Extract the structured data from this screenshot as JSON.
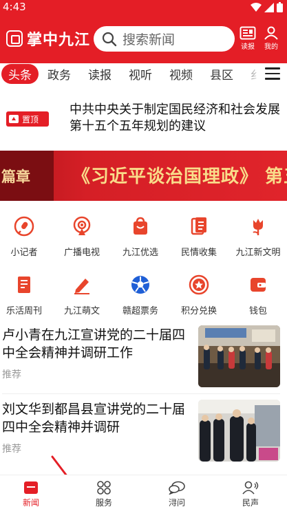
{
  "status": {
    "time": "4:43"
  },
  "app": {
    "title": "掌中九江"
  },
  "search": {
    "placeholder": "搜索新闻"
  },
  "header_buttons": {
    "read_paper": "读报",
    "mine": "我的"
  },
  "tabs": [
    {
      "label": "头条",
      "active": true
    },
    {
      "label": "政务",
      "active": false
    },
    {
      "label": "读报",
      "active": false
    },
    {
      "label": "视听",
      "active": false
    },
    {
      "label": "视频",
      "active": false
    },
    {
      "label": "县区",
      "active": false
    },
    {
      "label": "纟",
      "active": false
    }
  ],
  "pinned": {
    "badge": "置顶",
    "title": "中共中央关于制定国民经济和社会发展第十五个五年规划的建议"
  },
  "banner": {
    "left_text": "篇章",
    "text": "《习近平谈治国理政》 第五"
  },
  "services_row1": [
    {
      "label": "小记者",
      "icon": "microphone-icon"
    },
    {
      "label": "广播电视",
      "icon": "broadcast-icon"
    },
    {
      "label": "九江优选",
      "icon": "shopping-bag-icon"
    },
    {
      "label": "民情收集",
      "icon": "document-icon"
    },
    {
      "label": "九江新文明",
      "icon": "flower-icon"
    }
  ],
  "services_row2": [
    {
      "label": "乐活周刊",
      "icon": "journal-icon"
    },
    {
      "label": "九江萌文",
      "icon": "pen-icon"
    },
    {
      "label": "赣超票务",
      "icon": "soccer-ball-icon"
    },
    {
      "label": "积分兑换",
      "icon": "star-badge-icon"
    },
    {
      "label": "钱包",
      "icon": "wallet-icon"
    }
  ],
  "news": [
    {
      "title": "卢小青在九江宣讲党的二十届四中全会精神并调研工作",
      "tag": "推荐"
    },
    {
      "title": "刘文华到都昌县宣讲党的二十届四中全会精神并调研",
      "tag": "推荐"
    }
  ],
  "bottom_nav": [
    {
      "label": "新闻",
      "icon": "news-icon",
      "active": true
    },
    {
      "label": "服务",
      "icon": "services-icon",
      "active": false
    },
    {
      "label": "浔问",
      "icon": "chat-icon",
      "active": false
    },
    {
      "label": "民声",
      "icon": "people-voice-icon",
      "active": false
    }
  ],
  "colors": {
    "brand_red": "#e41e26",
    "banner_gold": "#f9dc8a",
    "annotation_arrow": "#e41e26"
  }
}
